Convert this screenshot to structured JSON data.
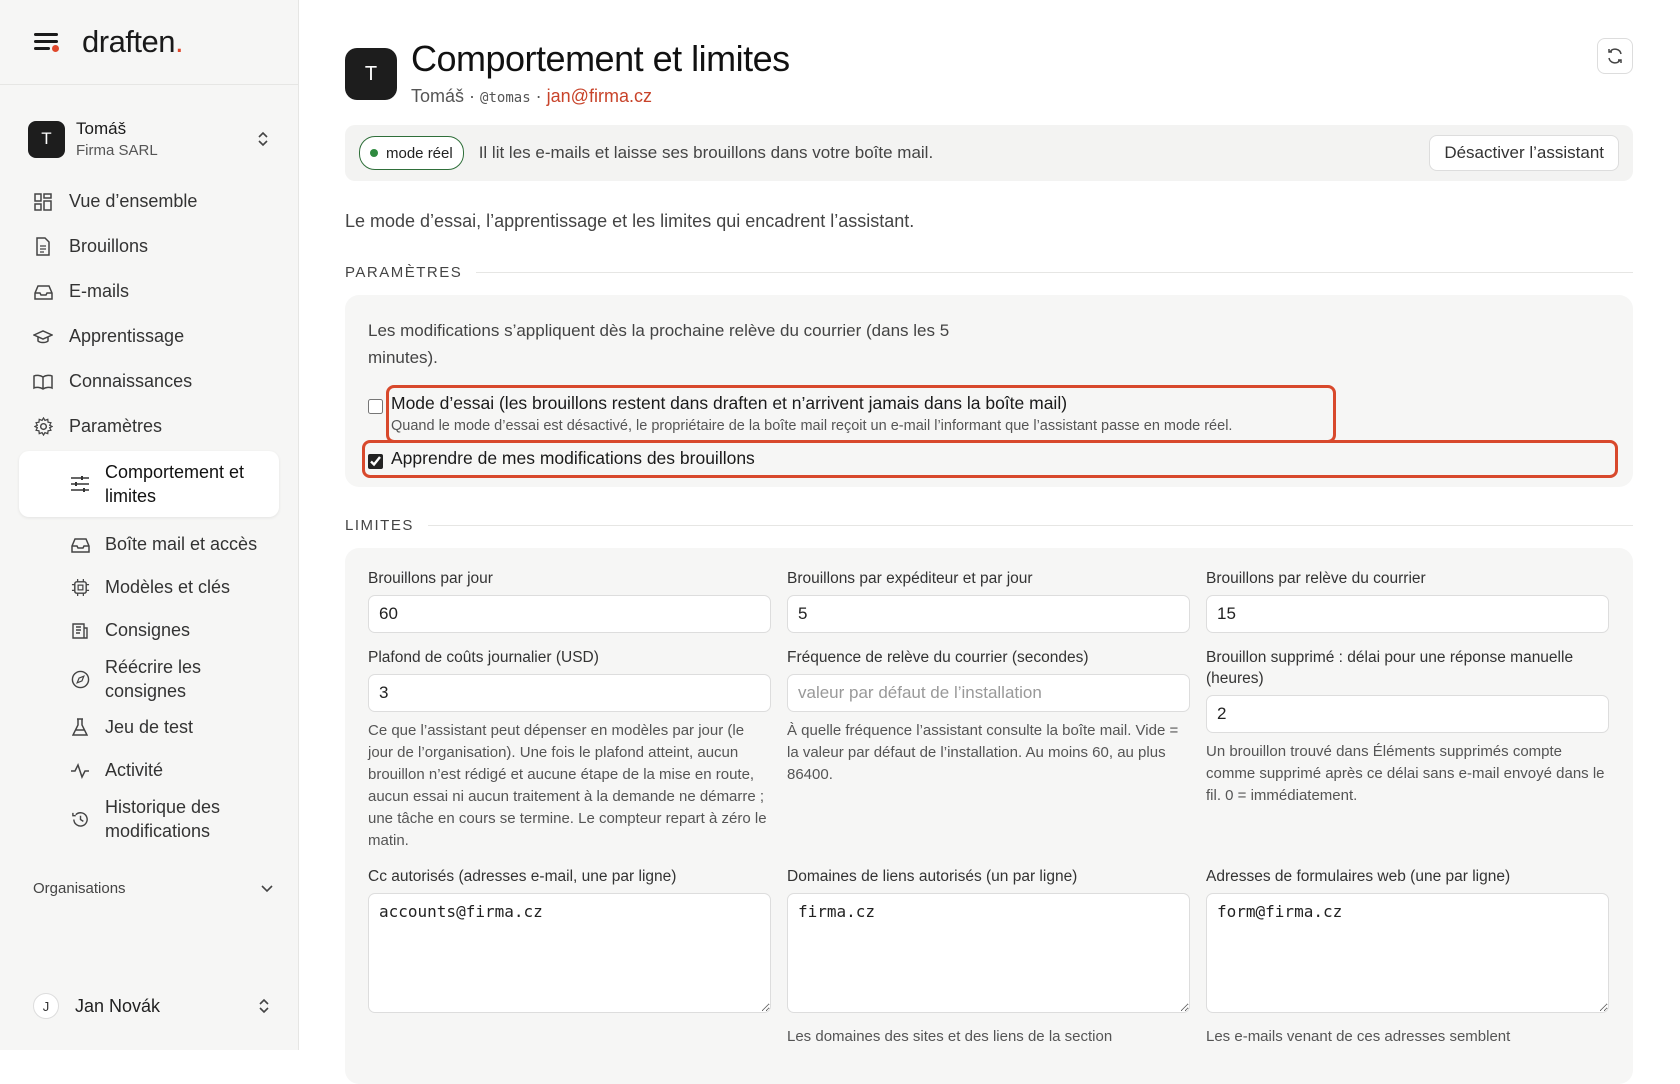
{
  "brand": {
    "name": "draften",
    "dot": "."
  },
  "workspace": {
    "initial": "T",
    "name": "Tomáš",
    "org": "Firma SARL"
  },
  "nav": {
    "overview": "Vue d’ensemble",
    "drafts": "Brouillons",
    "emails": "E-mails",
    "learning": "Apprentissage",
    "knowledge": "Connaissances",
    "settings": "Paramètres"
  },
  "subnav": {
    "behavior": "Comportement et limites",
    "mailbox": "Boîte mail et accès",
    "models": "Modèles et clés",
    "instructions": "Consignes",
    "rewrite": "Réécrire les consignes",
    "testset": "Jeu de test",
    "activity": "Activité",
    "history": "Historique des modifications"
  },
  "organisations": "Organisations",
  "user": {
    "initial": "J",
    "name": "Jan Novák"
  },
  "header": {
    "initial": "T",
    "title": "Comportement et limites",
    "name": "Tomáš",
    "sep": "·",
    "handle": "@tomas",
    "email": "jan@firma.cz"
  },
  "banner": {
    "mode": "mode réel",
    "text": "Il lit les e-mails et laisse ses brouillons dans votre boîte mail.",
    "button": "Désactiver l’assistant"
  },
  "intro": "Le mode d’essai, l’apprentissage et les limites qui encadrent l’assistant.",
  "params": {
    "heading": "PARAMÈTRES",
    "note": "Les modifications s’appliquent dès la prochaine relève du courrier (dans les 5 minutes).",
    "trial_label": "Mode d’essai (les brouillons restent dans draften et n’arrivent jamais dans la boîte mail)",
    "trial_hint": "Quand le mode d’essai est désactivé, le propriétaire de la boîte mail reçoit un e-mail l’informant que l’assistant passe en mode réel.",
    "trial_checked": false,
    "learn_label": "Apprendre de mes modifications des brouillons",
    "learn_checked": true
  },
  "limits": {
    "heading": "LIMITES",
    "per_day_label": "Brouillons par jour",
    "per_day": "60",
    "per_sender_label": "Brouillons par expéditeur et par jour",
    "per_sender": "5",
    "per_fetch_label": "Brouillons par relève du courrier",
    "per_fetch": "15",
    "cost_label": "Plafond de coûts journalier (USD)",
    "cost": "3",
    "cost_help": "Ce que l’assistant peut dépenser en modèles par jour (le jour de l’organisation). Une fois le plafond atteint, aucun brouillon n’est rédigé et aucune étape de la mise en route, aucun essai ni aucun traitement à la demande ne démarre ; une tâche en cours se termine. Le compteur repart à zéro le matin.",
    "freq_label": "Fréquence de relève du courrier (secondes)",
    "freq_placeholder": "valeur par défaut de l’installation",
    "freq_help": "À quelle fréquence l’assistant consulte la boîte mail. Vide = la valeur par défaut de l’installation. Au moins 60, au plus 86400.",
    "deleted_label": "Brouillon supprimé : délai pour une réponse manuelle (heures)",
    "deleted": "2",
    "deleted_help": "Un brouillon trouvé dans Éléments supprimés compte comme supprimé après ce délai sans e-mail envoyé dans le fil. 0 = immédiatement.",
    "cc_label": "Cc autorisés (adresses e-mail, une par ligne)",
    "cc": "accounts@firma.cz",
    "domains_label": "Domaines de liens autorisés (un par ligne)",
    "domains": "firma.cz",
    "domains_help": "Les domaines des sites et des liens de la section",
    "forms_label": "Adresses de formulaires web (une par ligne)",
    "forms": "form@firma.cz",
    "forms_help": "Les e-mails venant de ces adresses semblent"
  },
  "colors": {
    "accent": "#e0482b",
    "live": "#2f8a3f",
    "highlight": "#d8492c"
  }
}
